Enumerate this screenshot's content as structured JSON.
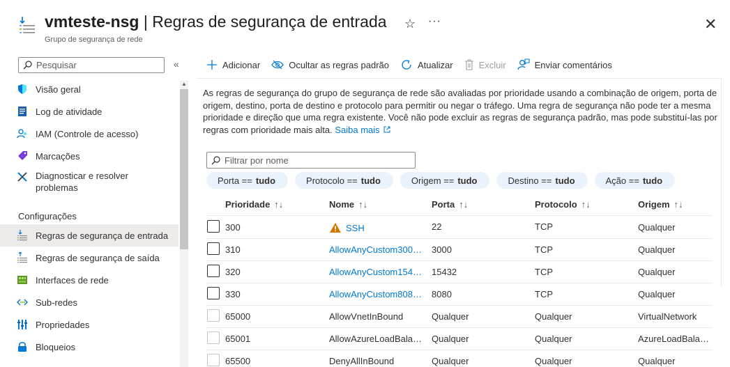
{
  "header": {
    "title_name": "vmteste-nsg",
    "title_separator": "|",
    "title_page": "Regras de segurança de entrada",
    "subtitle": "Grupo de segurança de rede",
    "star_glyph": "☆",
    "more_glyph": "···",
    "close_glyph": "✕"
  },
  "sidebar": {
    "search_placeholder": "Pesquisar",
    "collapse_glyph": "«",
    "items": [
      {
        "label": "Visão geral",
        "icon": "shield-icon"
      },
      {
        "label": "Log de atividade",
        "icon": "activity-log-icon"
      },
      {
        "label": "IAM (Controle de acesso)",
        "icon": "iam-icon"
      },
      {
        "label": "Marcações",
        "icon": "tag-icon"
      },
      {
        "label": "Diagnosticar e resolver problemas",
        "icon": "diagnose-icon"
      }
    ],
    "section": "Configurações",
    "settings_items": [
      {
        "label": "Regras de segurança de entrada",
        "icon": "inbound-rules-icon",
        "selected": true
      },
      {
        "label": "Regras de segurança de saída",
        "icon": "outbound-rules-icon"
      },
      {
        "label": "Interfaces de rede",
        "icon": "network-interface-icon"
      },
      {
        "label": "Sub-redes",
        "icon": "subnet-icon"
      },
      {
        "label": "Propriedades",
        "icon": "properties-icon"
      },
      {
        "label": "Bloqueios",
        "icon": "lock-icon"
      }
    ]
  },
  "toolbar": {
    "add": "Adicionar",
    "hide_default": "Ocultar as regras padrão",
    "refresh": "Atualizar",
    "delete": "Excluir",
    "feedback": "Enviar comentários"
  },
  "description": {
    "text": "As regras de segurança do grupo de segurança de rede são avaliadas por prioridade usando a combinação de origem, porta de origem, destino, porta de destino e protocolo para permitir ou negar o tráfego. Uma regra de segurança não pode ter a mesma prioridade e direção que uma regra existente. Você não pode excluir as regras de segurança padrão, mas pode substituí-las por regras com prioridade mais alta.",
    "link": "Saiba mais"
  },
  "filter": {
    "placeholder": "Filtrar por nome",
    "pills": [
      {
        "label": "Porta ==",
        "value": "tudo"
      },
      {
        "label": "Protocolo ==",
        "value": "tudo"
      },
      {
        "label": "Origem ==",
        "value": "tudo"
      },
      {
        "label": "Destino ==",
        "value": "tudo"
      },
      {
        "label": "Ação ==",
        "value": "tudo"
      }
    ]
  },
  "table": {
    "columns": [
      "Prioridade",
      "Nome",
      "Porta",
      "Protocolo",
      "Origem"
    ],
    "rows": [
      {
        "priority": "300",
        "name": "SSH",
        "port": "22",
        "protocol": "TCP",
        "source": "Qualquer",
        "link": true,
        "warning": true,
        "editable": true
      },
      {
        "priority": "310",
        "name": "AllowAnyCustom3000I...",
        "port": "3000",
        "protocol": "TCP",
        "source": "Qualquer",
        "link": true,
        "editable": true
      },
      {
        "priority": "320",
        "name": "AllowAnyCustom1543...",
        "port": "15432",
        "protocol": "TCP",
        "source": "Qualquer",
        "link": true,
        "editable": true
      },
      {
        "priority": "330",
        "name": "AllowAnyCustom8080I...",
        "port": "8080",
        "protocol": "TCP",
        "source": "Qualquer",
        "link": true,
        "editable": true
      },
      {
        "priority": "65000",
        "name": "AllowVnetInBound",
        "port": "Qualquer",
        "protocol": "Qualquer",
        "source": "VirtualNetwork",
        "editable": false
      },
      {
        "priority": "65001",
        "name": "AllowAzureLoadBalan...",
        "port": "Qualquer",
        "protocol": "Qualquer",
        "source": "AzureLoadBalance",
        "editable": false
      },
      {
        "priority": "65500",
        "name": "DenyAllInBound",
        "port": "Qualquer",
        "protocol": "Qualquer",
        "source": "Qualquer",
        "editable": false
      }
    ]
  },
  "colors": {
    "accent": "#0078d4",
    "pill_bg": "#eaf3fc",
    "selected_bg": "#edebe9",
    "warning": "#d47500"
  }
}
